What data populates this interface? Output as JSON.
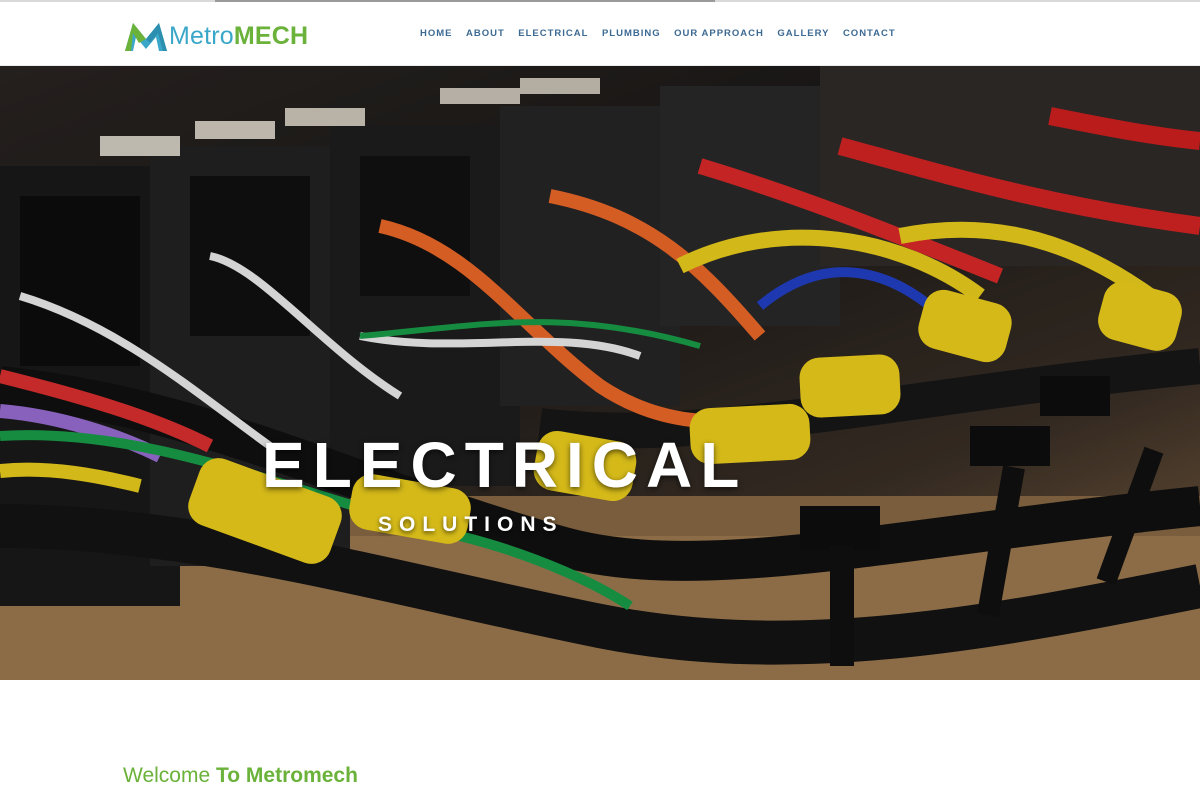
{
  "brand": {
    "name_part1": "Metro",
    "name_part2": "MECH",
    "primary_color": "#3aa7c8",
    "accent_color": "#6ab23a",
    "logo_icon": "metromech-logo-icon"
  },
  "nav": {
    "items": [
      {
        "label": "HOME"
      },
      {
        "label": "ABOUT"
      },
      {
        "label": "ELECTRICAL"
      },
      {
        "label": "PLUMBING"
      },
      {
        "label": "OUR APPROACH"
      },
      {
        "label": "GALLERY"
      },
      {
        "label": "CONTACT"
      }
    ],
    "color": "#3d6a93"
  },
  "hero": {
    "title": "ELECTRICAL",
    "subtitle": "SOLUTIONS"
  },
  "welcome": {
    "part1": "Welcome",
    "part2": "To Metromech"
  }
}
